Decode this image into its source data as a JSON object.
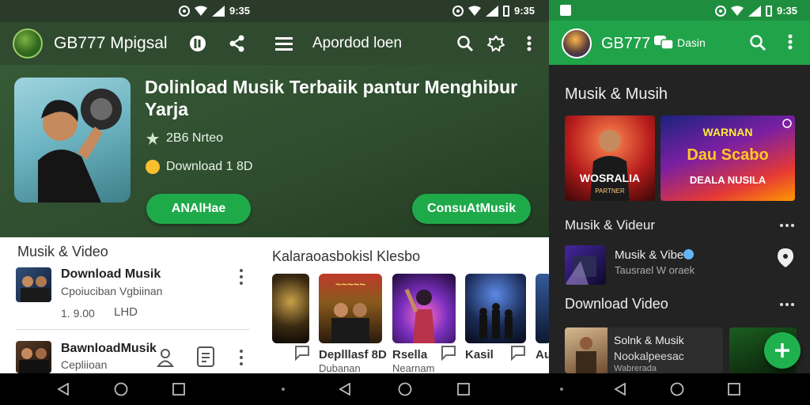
{
  "left": {
    "status": {
      "time": "9:35"
    },
    "appbar": {
      "title": "GB777 Mpigsal",
      "menu_label": "Apordod loen"
    },
    "hero": {
      "title": "Dolinload Musik Terbaiik pantur Menghibur Yarja",
      "rating_text": "2B6 Nrteo",
      "downloads_text": "Download 1 8D",
      "primary_button": "ANAlHae",
      "secondary_button": "ConsuAtMusik"
    },
    "section_list": {
      "title": "Musik & Video",
      "rows": [
        {
          "title": "Download Musik",
          "subtitle": "Cpoiuciban Vgbiinan",
          "price": "1. 9.00",
          "quality": "LHD"
        },
        {
          "title": "BawnloadMusik",
          "subtitle": "Cepliioan"
        }
      ]
    },
    "section_cards": {
      "title": "Kalaraoasbokisl Klesbo",
      "cards": [
        {
          "label": "",
          "sub": ""
        },
        {
          "label": "Deplllasf 8D",
          "sub": "Dubanan"
        },
        {
          "label": "Rsella",
          "sub": "Nearnam"
        },
        {
          "label": "Kasil",
          "sub": ""
        },
        {
          "label": "Au",
          "sub": ""
        }
      ]
    }
  },
  "right": {
    "status": {
      "time": "9:35"
    },
    "appbar": {
      "title": "GB777",
      "chip_label": "Dasin"
    },
    "sections": [
      {
        "title": "Musik & Musih"
      },
      {
        "title": "Musik & Videur"
      },
      {
        "title": "Download Video"
      }
    ],
    "feature_cards": [
      {
        "label_top": "",
        "label_main": "WOSRALIA",
        "label_sub": "PARTNER"
      },
      {
        "label_top": "WARNAN",
        "label_main": "Dau Scabo",
        "label_sub": "DEALA NUSILA"
      }
    ],
    "video_row": {
      "title": "Musik & Vibe",
      "subtitle": "Tausrael W oraek"
    },
    "bottom_card": {
      "title": "Solnk & Musik",
      "subtitle": "Nookalpeesac",
      "caption": "Wabrerada"
    }
  },
  "colors": {
    "accent": "#1faa4a",
    "appbar_left": "#2f4a2f",
    "appbar_right": "#21a34a"
  }
}
